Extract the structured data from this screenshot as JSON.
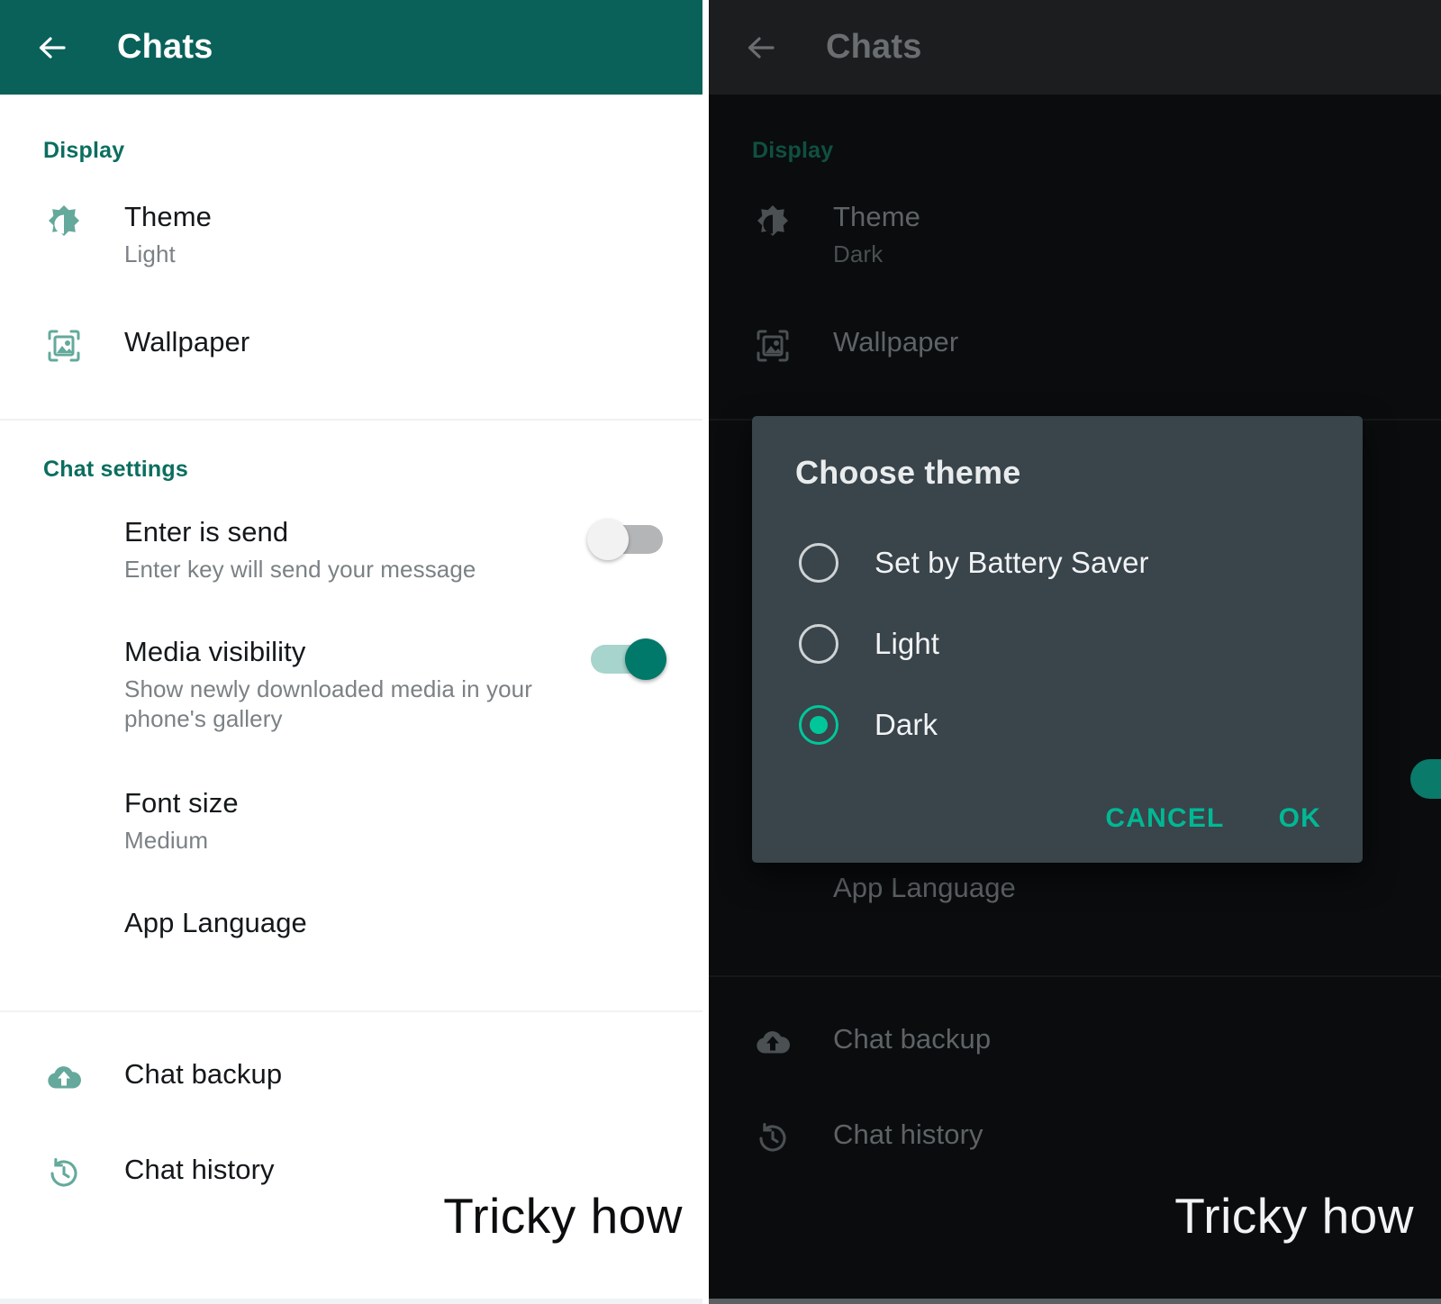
{
  "app": {
    "title": "Chats",
    "back_icon": "arrow-left-icon"
  },
  "left_screen": {
    "theme_mode": "light",
    "sections": [
      {
        "header": "Display",
        "items": [
          {
            "icon": "brightness-theme-icon",
            "title": "Theme",
            "subtitle": "Light",
            "control": "none"
          },
          {
            "icon": "wallpaper-image-icon",
            "title": "Wallpaper",
            "subtitle": "",
            "control": "none"
          }
        ]
      },
      {
        "header": "Chat settings",
        "items": [
          {
            "icon": "none",
            "title": "Enter is send",
            "subtitle": "Enter key will send your message",
            "control": "toggle",
            "toggle_on": false
          },
          {
            "icon": "none",
            "title": "Media visibility",
            "subtitle": "Show newly downloaded media in your phone's gallery",
            "control": "toggle",
            "toggle_on": true
          },
          {
            "icon": "none",
            "title": "Font size",
            "subtitle": "Medium",
            "control": "none"
          },
          {
            "icon": "none",
            "title": "App Language",
            "subtitle": "",
            "control": "none"
          }
        ]
      },
      {
        "header": "",
        "items": [
          {
            "icon": "cloud-upload-icon",
            "title": "Chat backup",
            "subtitle": "",
            "control": "none"
          },
          {
            "icon": "history-clock-icon",
            "title": "Chat history",
            "subtitle": "",
            "control": "none"
          }
        ]
      }
    ],
    "watermark": "Tricky how"
  },
  "right_screen": {
    "theme_mode": "dark",
    "sections": [
      {
        "header": "Display",
        "items": [
          {
            "icon": "brightness-theme-icon",
            "title": "Theme",
            "subtitle": "Dark",
            "control": "none"
          },
          {
            "icon": "wallpaper-image-icon",
            "title": "Wallpaper",
            "subtitle": "",
            "control": "none"
          }
        ]
      }
    ],
    "below_dialog": [
      {
        "icon": "none",
        "title": "App Language",
        "subtitle": ""
      },
      {
        "icon": "cloud-upload-icon",
        "title": "Chat backup",
        "subtitle": ""
      },
      {
        "icon": "history-clock-icon",
        "title": "Chat history",
        "subtitle": ""
      }
    ],
    "watermark": "Tricky how",
    "dialog": {
      "title": "Choose theme",
      "options": [
        {
          "label": "Set by Battery Saver",
          "selected": false
        },
        {
          "label": "Light",
          "selected": false
        },
        {
          "label": "Dark",
          "selected": true
        }
      ],
      "cancel_label": "CANCEL",
      "ok_label": "OK"
    }
  },
  "colors": {
    "brand_green": "#09615a",
    "accent_teal": "#00b894",
    "icon_green": "#64a99b",
    "toggle_on": "#00786a",
    "dialog_bg": "#39444b",
    "dark_bg": "#0a0c0d"
  }
}
